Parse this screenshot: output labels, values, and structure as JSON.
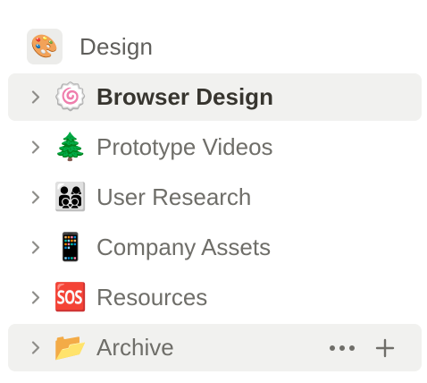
{
  "section": {
    "icon": "🎨",
    "icon_name": "palette-icon",
    "title": "Design"
  },
  "pages": [
    {
      "icon": "🍥",
      "icon_name": "fish-cake-icon",
      "label": "Browser Design",
      "state": "selected"
    },
    {
      "icon": "🌲",
      "icon_name": "evergreen-tree-icon",
      "label": "Prototype Videos",
      "state": "normal"
    },
    {
      "icon": "👨‍👩‍👦‍👦",
      "icon_name": "family-icon",
      "label": "User Research",
      "state": "normal"
    },
    {
      "icon": "📱",
      "icon_name": "mobile-phone-icon",
      "label": "Company Assets",
      "state": "normal"
    },
    {
      "icon": "🆘",
      "icon_name": "sos-icon",
      "label": "Resources",
      "state": "normal"
    },
    {
      "icon": "📂",
      "icon_name": "open-folder-icon",
      "label": "Archive",
      "state": "hovered"
    }
  ],
  "colors": {
    "hover_background": "#f1f1ef",
    "text_primary": "#37352f",
    "text_secondary": "#6f6e69",
    "icon_gray": "#8e8d89"
  }
}
